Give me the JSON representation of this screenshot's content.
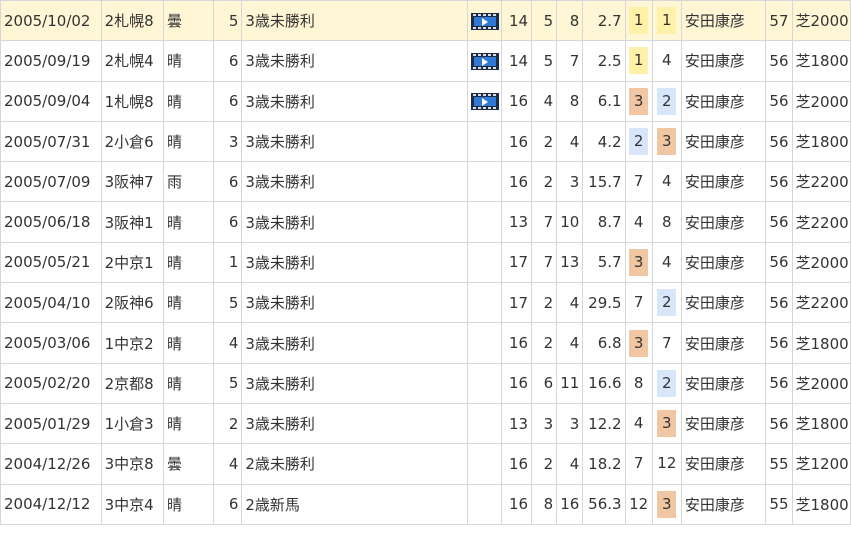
{
  "colors": {
    "row_highlight": "#fff6d6",
    "link": "#1d4f99",
    "text": "#333333",
    "border": "#d7d7d7",
    "first_place": "#fff2a8",
    "second_place": "#d7e6fb",
    "third_place": "#f1c7a3"
  },
  "rows": [
    {
      "date": "2005/10/02",
      "venue": "2札幌8",
      "weather": "曇",
      "race_no": "5",
      "race_name": "3歳未勝利",
      "video": true,
      "field": "14",
      "gate": "5",
      "horse_no": "8",
      "odds": "2.7",
      "pop": "1",
      "finish": "1",
      "jockey": "安田康彦",
      "weight": "57",
      "course": "芝2000",
      "highlight": true
    },
    {
      "date": "2005/09/19",
      "venue": "2札幌4",
      "weather": "晴",
      "race_no": "6",
      "race_name": "3歳未勝利",
      "video": true,
      "field": "14",
      "gate": "5",
      "horse_no": "7",
      "odds": "2.5",
      "pop": "1",
      "finish": "4",
      "jockey": "安田康彦",
      "weight": "56",
      "course": "芝1800",
      "highlight": false
    },
    {
      "date": "2005/09/04",
      "venue": "1札幌8",
      "weather": "晴",
      "race_no": "6",
      "race_name": "3歳未勝利",
      "video": true,
      "field": "16",
      "gate": "4",
      "horse_no": "8",
      "odds": "6.1",
      "pop": "3",
      "finish": "2",
      "jockey": "安田康彦",
      "weight": "56",
      "course": "芝2000",
      "highlight": false
    },
    {
      "date": "2005/07/31",
      "venue": "2小倉6",
      "weather": "晴",
      "race_no": "3",
      "race_name": "3歳未勝利",
      "video": false,
      "field": "16",
      "gate": "2",
      "horse_no": "4",
      "odds": "4.2",
      "pop": "2",
      "finish": "3",
      "jockey": "安田康彦",
      "weight": "56",
      "course": "芝1800",
      "highlight": false
    },
    {
      "date": "2005/07/09",
      "venue": "3阪神7",
      "weather": "雨",
      "race_no": "6",
      "race_name": "3歳未勝利",
      "video": false,
      "field": "16",
      "gate": "2",
      "horse_no": "3",
      "odds": "15.7",
      "pop": "7",
      "finish": "4",
      "jockey": "安田康彦",
      "weight": "56",
      "course": "芝2200",
      "highlight": false
    },
    {
      "date": "2005/06/18",
      "venue": "3阪神1",
      "weather": "晴",
      "race_no": "6",
      "race_name": "3歳未勝利",
      "video": false,
      "field": "13",
      "gate": "7",
      "horse_no": "10",
      "odds": "8.7",
      "pop": "4",
      "finish": "8",
      "jockey": "安田康彦",
      "weight": "56",
      "course": "芝2200",
      "highlight": false
    },
    {
      "date": "2005/05/21",
      "venue": "2中京1",
      "weather": "晴",
      "race_no": "1",
      "race_name": "3歳未勝利",
      "video": false,
      "field": "17",
      "gate": "7",
      "horse_no": "13",
      "odds": "5.7",
      "pop": "3",
      "finish": "4",
      "jockey": "安田康彦",
      "weight": "56",
      "course": "芝2000",
      "highlight": false
    },
    {
      "date": "2005/04/10",
      "venue": "2阪神6",
      "weather": "晴",
      "race_no": "5",
      "race_name": "3歳未勝利",
      "video": false,
      "field": "17",
      "gate": "2",
      "horse_no": "4",
      "odds": "29.5",
      "pop": "7",
      "finish": "2",
      "jockey": "安田康彦",
      "weight": "56",
      "course": "芝2200",
      "highlight": false
    },
    {
      "date": "2005/03/06",
      "venue": "1中京2",
      "weather": "晴",
      "race_no": "4",
      "race_name": "3歳未勝利",
      "video": false,
      "field": "16",
      "gate": "2",
      "horse_no": "4",
      "odds": "6.8",
      "pop": "3",
      "finish": "7",
      "jockey": "安田康彦",
      "weight": "56",
      "course": "芝1800",
      "highlight": false
    },
    {
      "date": "2005/02/20",
      "venue": "2京都8",
      "weather": "晴",
      "race_no": "5",
      "race_name": "3歳未勝利",
      "video": false,
      "field": "16",
      "gate": "6",
      "horse_no": "11",
      "odds": "16.6",
      "pop": "8",
      "finish": "2",
      "jockey": "安田康彦",
      "weight": "56",
      "course": "芝2000",
      "highlight": false
    },
    {
      "date": "2005/01/29",
      "venue": "1小倉3",
      "weather": "晴",
      "race_no": "2",
      "race_name": "3歳未勝利",
      "video": false,
      "field": "13",
      "gate": "3",
      "horse_no": "3",
      "odds": "12.2",
      "pop": "4",
      "finish": "3",
      "jockey": "安田康彦",
      "weight": "56",
      "course": "芝1800",
      "highlight": false
    },
    {
      "date": "2004/12/26",
      "venue": "3中京8",
      "weather": "曇",
      "race_no": "4",
      "race_name": "2歳未勝利",
      "video": false,
      "field": "16",
      "gate": "2",
      "horse_no": "4",
      "odds": "18.2",
      "pop": "7",
      "finish": "12",
      "jockey": "安田康彦",
      "weight": "55",
      "course": "芝1200",
      "highlight": false
    },
    {
      "date": "2004/12/12",
      "venue": "3中京4",
      "weather": "晴",
      "race_no": "6",
      "race_name": "2歳新馬",
      "video": false,
      "field": "16",
      "gate": "8",
      "horse_no": "16",
      "odds": "56.3",
      "pop": "12",
      "finish": "3",
      "jockey": "安田康彦",
      "weight": "55",
      "course": "芝1800",
      "highlight": false
    }
  ]
}
